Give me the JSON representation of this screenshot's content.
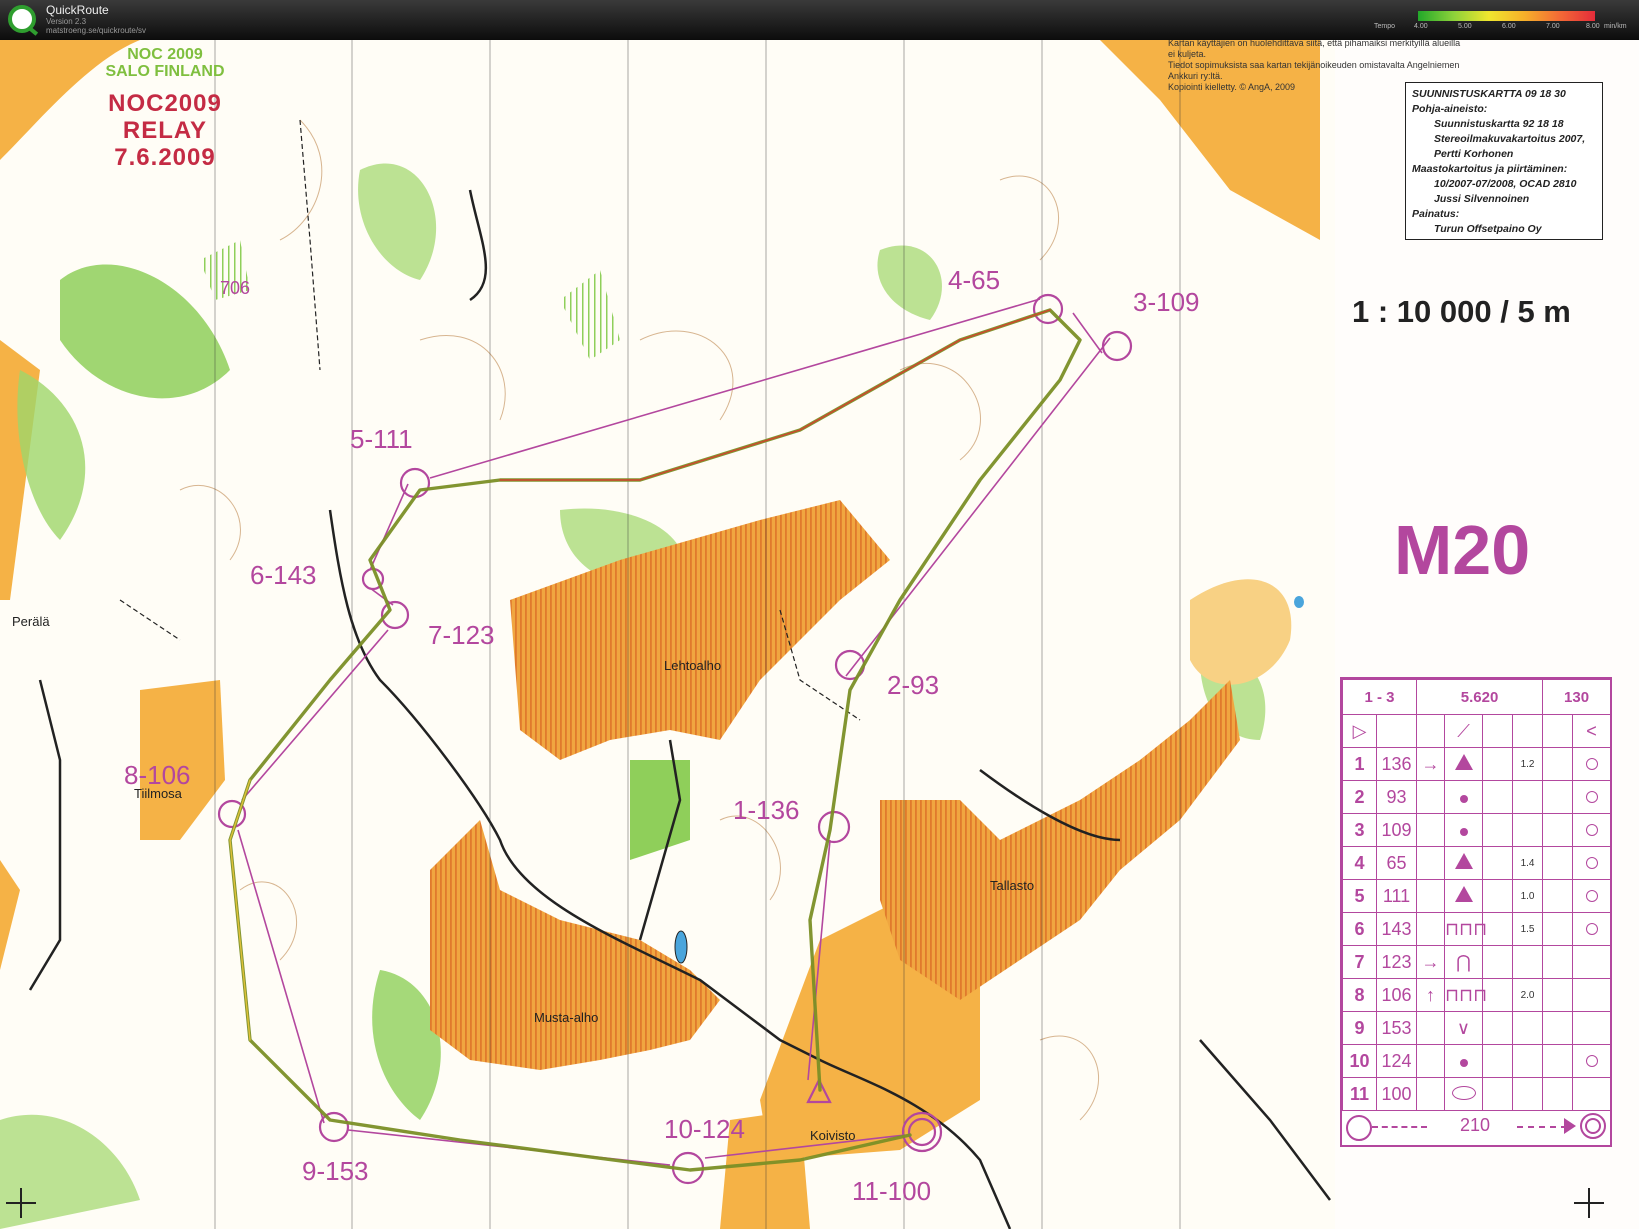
{
  "app": {
    "name": "QuickRoute",
    "version": "Version 2.3",
    "url": "matstroeng.se/quickroute/sv",
    "icon": "quickroute-logo-icon"
  },
  "tempo_legend": {
    "label": "Tempo",
    "ticks": [
      "4.00",
      "5.00",
      "6.00",
      "7.00",
      "8.00"
    ],
    "unit": "min/km",
    "colors": [
      "#22a82a",
      "#8cd23a",
      "#f0e62e",
      "#f6b02a",
      "#f36a36",
      "#e42c3a"
    ]
  },
  "map": {
    "event_title": [
      "NOC 2009",
      "SALO FINLAND"
    ],
    "relay_title": [
      "NOC2009",
      "RELAY",
      "7.6.2009"
    ],
    "copyright": [
      "Kartan käyttäjien on huolehdittava siitä, että pihamaiksi merkityillä alueilla ei kuljeta.",
      "Tiedot sopimuksista saa kartan tekijänoikeuden omistavalta Angelniemen Ankkuri ry:ltä.",
      "Kopiointi kielletty.   © AngA, 2009"
    ],
    "credits": [
      {
        "text": "SUUNNISTUSKARTTA 09 18 30",
        "indent": false
      },
      {
        "text": "Pohja-aineisto:",
        "indent": false
      },
      {
        "text": "Suunnistuskartta 92 18 18",
        "indent": true
      },
      {
        "text": "Stereoilmakuvakartoitus 2007,",
        "indent": true
      },
      {
        "text": "Pertti Korhonen",
        "indent": true
      },
      {
        "text": "Maastokartoitus ja piirtäminen:",
        "indent": false
      },
      {
        "text": "10/2007-07/2008, OCAD 2810",
        "indent": true
      },
      {
        "text": "Jussi Silvennoinen",
        "indent": true
      },
      {
        "text": "Painatus:",
        "indent": false
      },
      {
        "text": "Turun Offsetpaino Oy",
        "indent": true
      }
    ],
    "scale": "1 : 10 000 / 5 m",
    "course": "M20",
    "place_names": {
      "perala": "Perälä",
      "tiilmosa": "Tiilmosa",
      "lehtoalho": "Lehtoalho",
      "tallasto": "Tallasto",
      "musta_alho": "Musta-alho",
      "koivisto": "Koivisto",
      "height_706": "706"
    },
    "control_labels": [
      "1-136",
      "2-93",
      "3-109",
      "4-65",
      "5-111",
      "6-143",
      "7-123",
      "8-106",
      "9-153",
      "10-124",
      "11-100"
    ],
    "colors": {
      "course": "#b3479e",
      "open_land": "#f5b246",
      "forest_green": "#7fbf3f",
      "route_slow": "#d93a2f",
      "route_mid": "#8a9a2a"
    }
  },
  "description_sheet": {
    "header": {
      "class": "1 - 3",
      "length": "5.620",
      "climb": "130"
    },
    "controls": [
      {
        "num": "1",
        "code": "136",
        "dir": "→",
        "feature": "tri",
        "dim": "1.2",
        "loc": "ring"
      },
      {
        "num": "2",
        "code": "93",
        "dir": "",
        "feature": "dot",
        "dim": "",
        "loc": "ring"
      },
      {
        "num": "3",
        "code": "109",
        "dir": "",
        "feature": "dot",
        "dim": "",
        "loc": "ring"
      },
      {
        "num": "4",
        "code": "65",
        "dir": "",
        "feature": "tri",
        "dim": "1.4",
        "loc": "ring"
      },
      {
        "num": "5",
        "code": "111",
        "dir": "",
        "feature": "tri",
        "dim": "1.0",
        "loc": "ring"
      },
      {
        "num": "6",
        "code": "143",
        "dir": "",
        "feature": "wall",
        "dim": "1.5",
        "loc": "ring"
      },
      {
        "num": "7",
        "code": "123",
        "dir": "→",
        "feature": "knoll",
        "dim": "",
        "loc": ""
      },
      {
        "num": "8",
        "code": "106",
        "dir": "↑",
        "feature": "wall",
        "dim": "2.0",
        "loc": ""
      },
      {
        "num": "9",
        "code": "153",
        "dir": "",
        "feature": "v",
        "dim": "",
        "loc": ""
      },
      {
        "num": "10",
        "code": "124",
        "dir": "",
        "feature": "dot",
        "dim": "",
        "loc": "ring"
      },
      {
        "num": "11",
        "code": "100",
        "dir": "",
        "feature": "oval",
        "dim": "",
        "loc": ""
      }
    ],
    "finish_distance": "210"
  }
}
